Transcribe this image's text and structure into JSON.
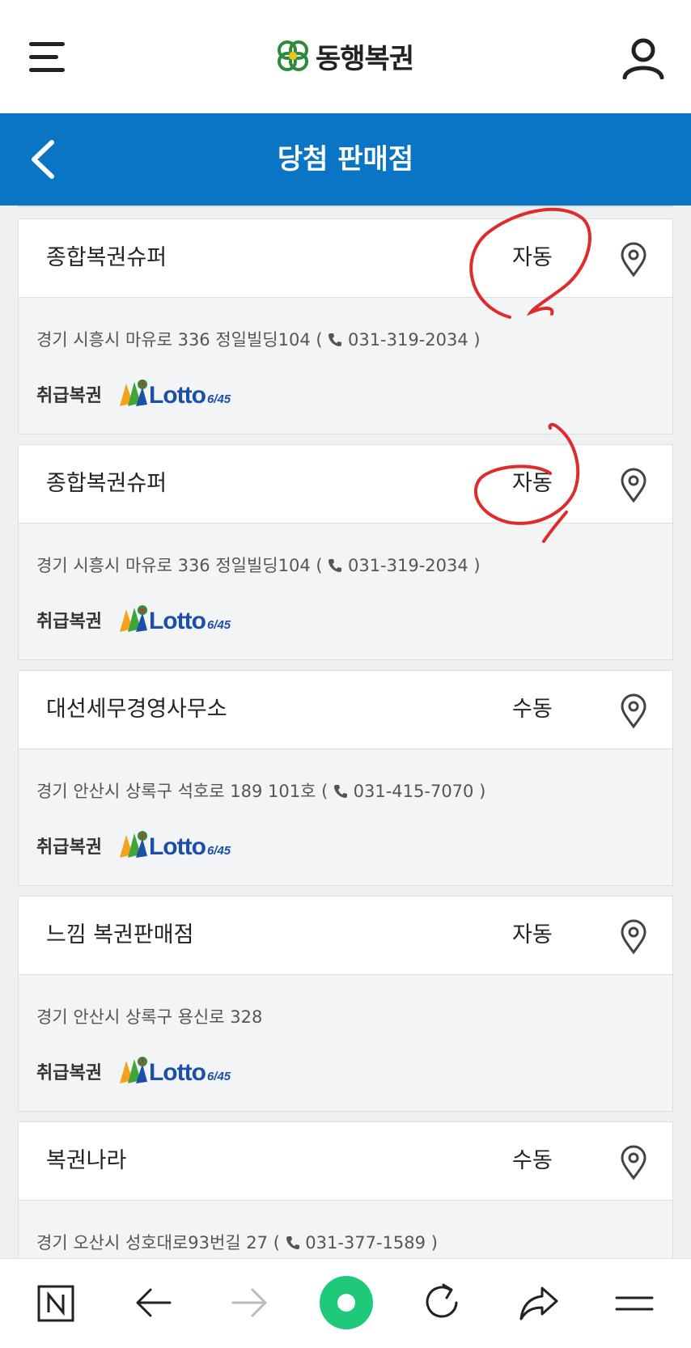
{
  "header": {
    "logo_text": "동행복권"
  },
  "title_bar": {
    "title": "당첨 판매점"
  },
  "colors": {
    "accent": "#0a75c5",
    "brand_green": "#2e8b3e",
    "annotation": "#e02b2b",
    "nav_home": "#1ec97a"
  },
  "stores": [
    {
      "name": "종합복권슈퍼",
      "method": "자동",
      "address": "경기 시흥시 마유로 336 정일빌딩104",
      "phone": "031-319-2034",
      "lotto_label": "취급복권",
      "lotto_brand": "Lotto",
      "lotto_sub": "6/45"
    },
    {
      "name": "종합복권슈퍼",
      "method": "자동",
      "address": "경기 시흥시 마유로 336 정일빌딩104",
      "phone": "031-319-2034",
      "lotto_label": "취급복권",
      "lotto_brand": "Lotto",
      "lotto_sub": "6/45"
    },
    {
      "name": "대선세무경영사무소",
      "method": "수동",
      "address": "경기 안산시 상록구 석호로 189 101호",
      "phone": "031-415-7070",
      "lotto_label": "취급복권",
      "lotto_brand": "Lotto",
      "lotto_sub": "6/45"
    },
    {
      "name": "느낌 복권판매점",
      "method": "자동",
      "address": "경기 안산시 상록구 용신로 328",
      "phone": "",
      "lotto_label": "취급복권",
      "lotto_brand": "Lotto",
      "lotto_sub": "6/45"
    },
    {
      "name": "복권나라",
      "method": "수동",
      "address": "경기 오산시 성호대로93번길 27",
      "phone": "031-377-1589",
      "lotto_label": "취급복권",
      "lotto_brand": "Lotto",
      "lotto_sub": "6/45"
    }
  ],
  "icons": {
    "menu": "hamburger-menu-icon",
    "user": "user-icon",
    "back": "chevron-left-icon",
    "map": "map-pin-icon",
    "phone": "phone-icon",
    "bottom_nav": [
      "naver-n-icon",
      "back-arrow-icon",
      "forward-arrow-icon",
      "home-circle-icon",
      "refresh-icon",
      "share-icon",
      "menu-icon"
    ]
  }
}
